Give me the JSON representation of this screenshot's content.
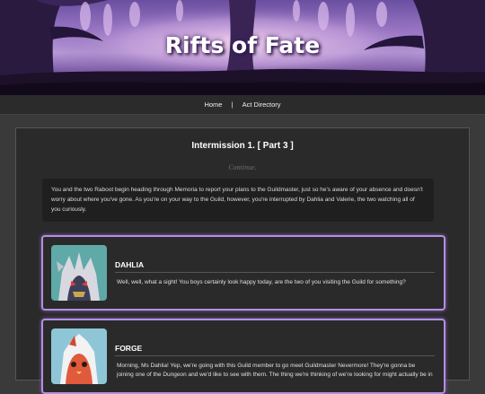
{
  "site": {
    "title": "Rifts of Fate"
  },
  "nav": {
    "home": "Home",
    "separator": "|",
    "act_directory": "Act Directory"
  },
  "chapter": {
    "title": "Intermission 1. [ Part 3 ]",
    "continue_label": "Continue."
  },
  "narration": "You and the two Raboot begin heading through Memoria to report your plans to the Guildmaster, just so he's aware of your absence and doesn't worry about where you've gone. As you're on your way to the Guild, however, you're interrupted by Dahlia and Valerie, the two watching all of you curiously.",
  "dialogues": [
    {
      "speaker": "DAHLIA",
      "portrait": "silvally-portrait",
      "text": "Well, well, what a sight! You boys certainly look happy today, are the two of you visiting the Guild for something?"
    },
    {
      "speaker": "FORGE",
      "portrait": "fire-pokemon-portrait",
      "text": "Morning, Ms Dahlia! Yep, we're going with this Guild member to go meet Guildmaster Nevermore! They're gonna be joining one of the Dungeon and we'd like to see with them. The thing we're thinking of we're looking for might actually be in"
    }
  ],
  "colors": {
    "accent_border": "#b58ee0",
    "panel_bg": "#2a2a2a",
    "page_bg": "#3a3a3a",
    "nav_bg": "#2b2b2b"
  }
}
